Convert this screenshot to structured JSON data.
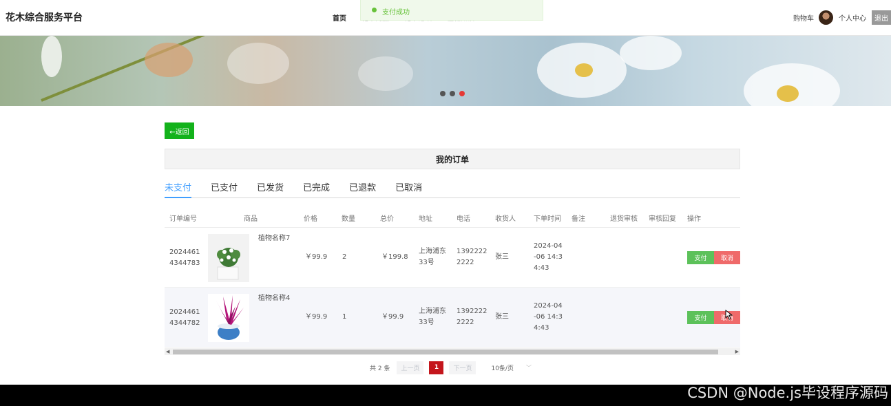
{
  "header": {
    "brand": "花木综合服务平台",
    "nav": [
      {
        "label": "首页",
        "active": true
      },
      {
        "label": "花木商品",
        "active": false
      },
      {
        "label": "花木论坛",
        "active": false
      },
      {
        "label": "植物知识",
        "active": false
      }
    ],
    "toast": "支付成功",
    "cart_label": "购物车",
    "user_center_label": "个人中心",
    "logout_label": "退出"
  },
  "banner": {
    "slide_count": 3,
    "active_slide": 3
  },
  "back_label": "←返回",
  "page_title": "我的订单",
  "tabs": [
    {
      "label": "未支付",
      "active": true
    },
    {
      "label": "已支付",
      "active": false
    },
    {
      "label": "已发货",
      "active": false
    },
    {
      "label": "已完成",
      "active": false
    },
    {
      "label": "已退款",
      "active": false
    },
    {
      "label": "已取消",
      "active": false
    }
  ],
  "table": {
    "headers": [
      "订单编号",
      "商品",
      "价格",
      "数量",
      "总价",
      "地址",
      "电话",
      "收货人",
      "下单时间",
      "备注",
      "退货审核",
      "审核回复",
      "操作"
    ],
    "rows": [
      {
        "order_no": "20244614344783",
        "product": "植物名称7",
        "product_image": "potted-white-flower-icon",
        "price": "￥99.9",
        "qty": "2",
        "total": "￥199.8",
        "address": "上海浦东33号",
        "phone": "13922222222",
        "receiver": "张三",
        "time": "2024-04-06 14:34:43",
        "note": "",
        "return_review": "",
        "review_reply": "",
        "pay_label": "支付",
        "cancel_label": "取消"
      },
      {
        "order_no": "20244614344782",
        "product": "植物名称4",
        "product_image": "potted-purple-plant-icon",
        "price": "￥99.9",
        "qty": "1",
        "total": "￥99.9",
        "address": "上海浦东33号",
        "phone": "13922222222",
        "receiver": "张三",
        "time": "2024-04-06 14:34:43",
        "note": "",
        "return_review": "",
        "review_reply": "",
        "pay_label": "支付",
        "cancel_label": "取消"
      }
    ]
  },
  "pagination": {
    "total_label": "共 2 条",
    "prev_label": "上一页",
    "current_page": "1",
    "next_label": "下一页",
    "page_size_label": "10条/页"
  },
  "watermark": "CSDN @Node.js毕设程序源码",
  "colors": {
    "accent": "#409eff",
    "back_button": "#13b21b",
    "pay_button": "#5cc15a",
    "cancel_button": "#ef6a6a",
    "current_page": "#c4161c"
  }
}
